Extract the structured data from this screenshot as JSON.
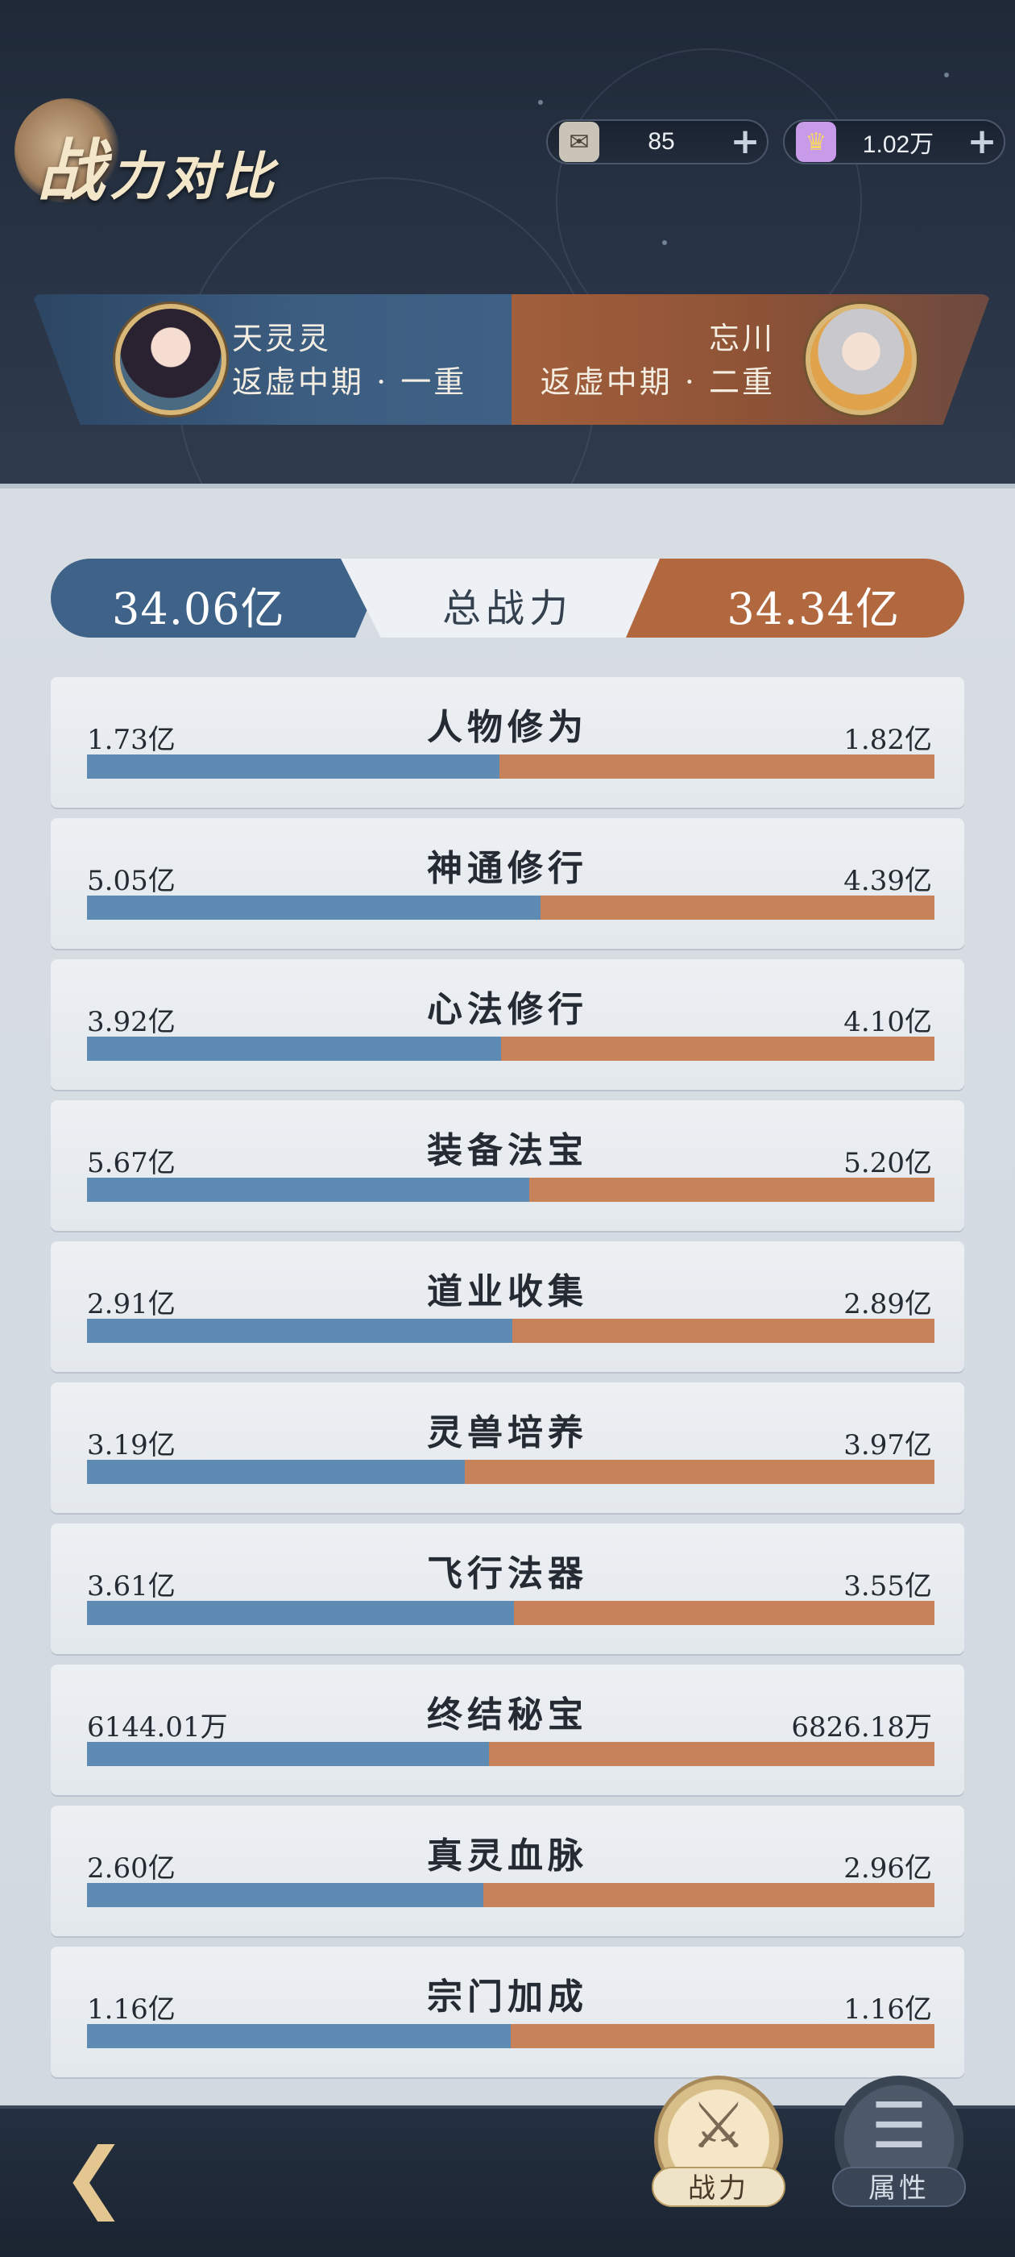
{
  "header": {
    "title_big": "战",
    "title_rest": "力对比",
    "currency": [
      {
        "icon": "scroll-icon",
        "value": "85",
        "plus": "+"
      },
      {
        "icon": "gem-ticket-icon",
        "value": "1.02万",
        "plus": "+"
      }
    ]
  },
  "players": {
    "left": {
      "name": "天灵灵",
      "realm": "返虚中期 · 一重"
    },
    "right": {
      "name": "忘川",
      "realm": "返虚中期 · 二重"
    }
  },
  "total": {
    "left": "34.06亿",
    "label": "总战力",
    "right": "34.34亿"
  },
  "stats": [
    {
      "label": "人物修为",
      "left": "1.73亿",
      "right": "1.82亿",
      "left_share": 0.487
    },
    {
      "label": "神通修行",
      "left": "5.05亿",
      "right": "4.39亿",
      "left_share": 0.535
    },
    {
      "label": "心法修行",
      "left": "3.92亿",
      "right": "4.10亿",
      "left_share": 0.489
    },
    {
      "label": "装备法宝",
      "left": "5.67亿",
      "right": "5.20亿",
      "left_share": 0.522
    },
    {
      "label": "道业收集",
      "left": "2.91亿",
      "right": "2.89亿",
      "left_share": 0.502
    },
    {
      "label": "灵兽培养",
      "left": "3.19亿",
      "right": "3.97亿",
      "left_share": 0.446
    },
    {
      "label": "飞行法器",
      "left": "3.61亿",
      "right": "3.55亿",
      "left_share": 0.504
    },
    {
      "label": "终结秘宝",
      "left": "6144.01万",
      "right": "6826.18万",
      "left_share": 0.474
    },
    {
      "label": "真灵血脉",
      "left": "2.60亿",
      "right": "2.96亿",
      "left_share": 0.468
    },
    {
      "label": "宗门加成",
      "left": "1.16亿",
      "right": "1.16亿",
      "left_share": 0.5
    }
  ],
  "nav": {
    "back_icon": "back-arrow-icon",
    "active": {
      "label": "战力",
      "icon": "crossed-swords-icon"
    },
    "inactive": {
      "label": "属性",
      "icon": "attribute-list-icon"
    }
  },
  "colors": {
    "left_team": "#5d8bb3",
    "right_team": "#c8825a"
  }
}
